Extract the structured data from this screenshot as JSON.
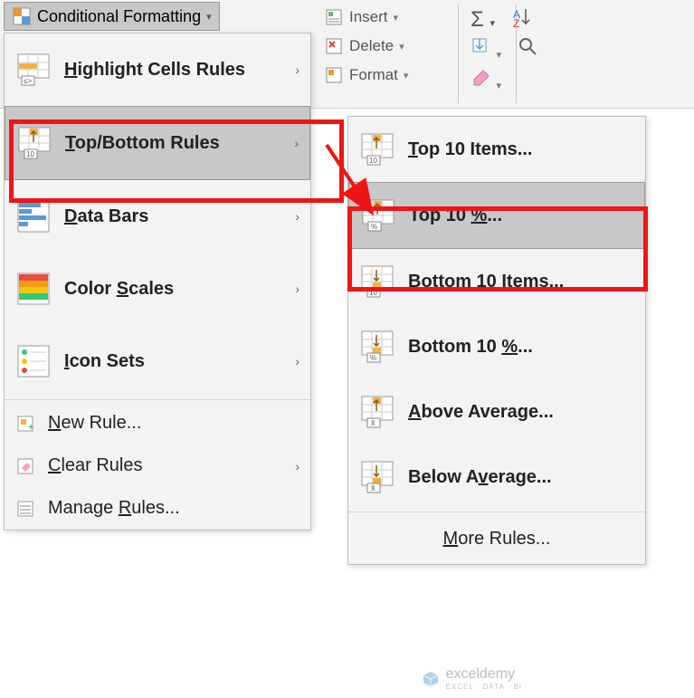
{
  "cf_button": "Conditional Formatting",
  "ribbon": {
    "insert": "Insert",
    "delete": "Delete",
    "format": "Format"
  },
  "menu": {
    "highlight": "Highlight Cells Rules",
    "topbottom": "Top/Bottom Rules",
    "databars": "Data Bars",
    "colorscales": "Color Scales",
    "iconsets": "Icon Sets",
    "newrule": "New Rule...",
    "clearrules": "Clear Rules",
    "managerules": "Manage Rules..."
  },
  "submenu": {
    "top10items": "Top 10 Items...",
    "top10pct": "Top 10 %...",
    "bottom10items": "Bottom 10 Items...",
    "bottom10pct": "Bottom 10 %...",
    "aboveavg": "Above Average...",
    "belowavg": "Below Average...",
    "morerules": "More Rules..."
  },
  "watermark": {
    "name": "exceldemy",
    "sub": "EXCEL · DATA · BI"
  }
}
